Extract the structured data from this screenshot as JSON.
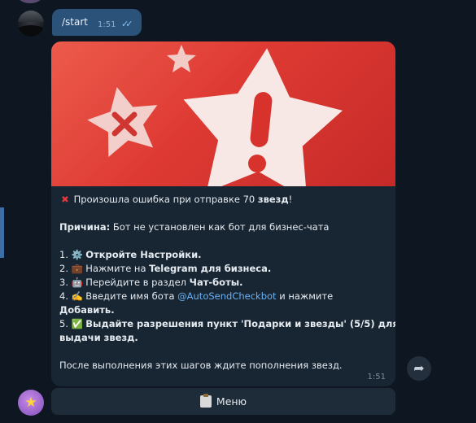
{
  "user_message": {
    "text": "/start",
    "time": "1:51",
    "ticks": "✓✓"
  },
  "bot_message": {
    "error_line": "Произошла ошибка при отправке 70 ",
    "error_bold": "звезд",
    "error_end": "!",
    "reason_label": "Причина:",
    "reason_text": " Бот не установлен как бот для бизнес-чата",
    "steps": [
      {
        "num": "1.",
        "icon": "⚙️",
        "pre": "",
        "bold": "Откройте Настройки.",
        "post": ""
      },
      {
        "num": "2.",
        "icon": "💼",
        "pre": "Нажмите на ",
        "bold": "Telegram для бизнеса.",
        "post": ""
      },
      {
        "num": "3.",
        "icon": "🤖",
        "pre": "Перейдите в раздел ",
        "bold": "Чат-боты.",
        "post": ""
      },
      {
        "num": "4.",
        "icon": "✍️",
        "pre": "Введите имя бота ",
        "mention": "@AutoSendCheckbot",
        "post": " и нажмите",
        "bold2": "Добавить."
      },
      {
        "num": "5.",
        "icon": "✅",
        "bold": "Выдайте разрешения пункт 'Подарки и звезды' (5/5) для",
        "bold_cont": "выдачи звезд."
      }
    ],
    "footer_text": "После выполнения этих шагов ждите пополнения звезд.",
    "time": "1:51"
  },
  "menu_button": {
    "label": "Меню"
  },
  "colors": {
    "background": "#0e1621",
    "outgoing_bubble": "#2b5278",
    "incoming_bubble": "#182533",
    "banner_red": "#de3a33",
    "link": "#6ab2f2"
  }
}
